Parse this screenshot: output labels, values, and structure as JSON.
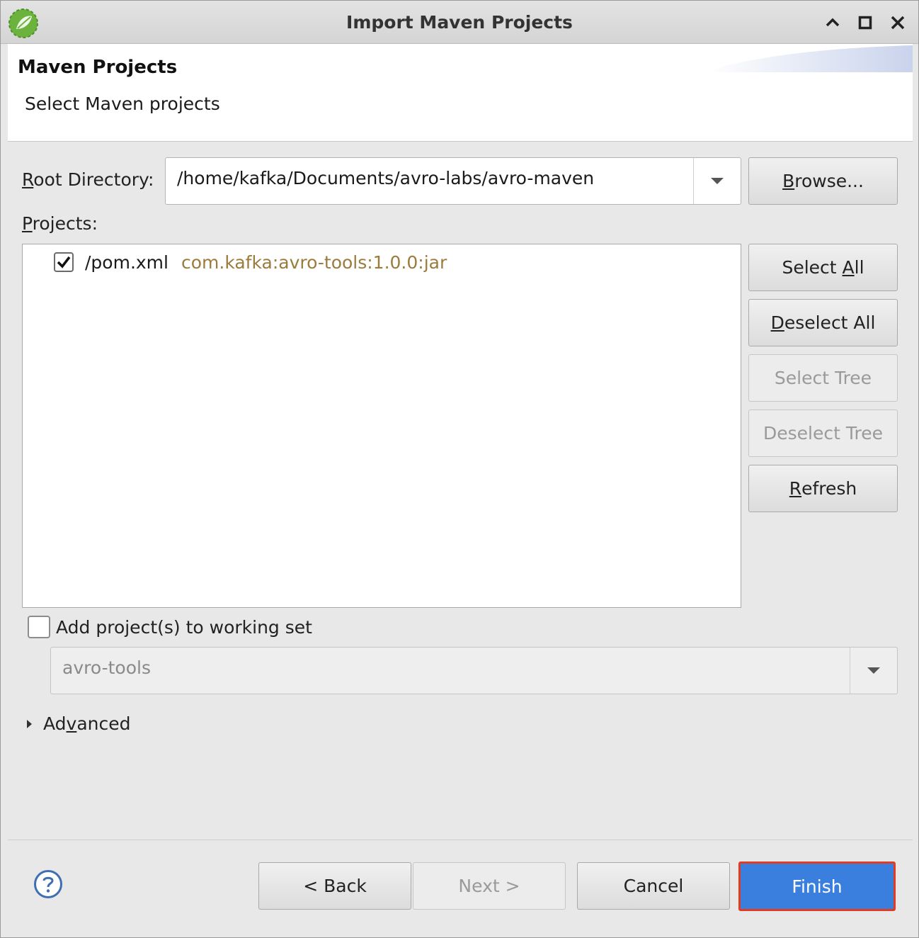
{
  "window": {
    "title": "Import Maven Projects"
  },
  "header": {
    "title": "Maven Projects",
    "subtitle": "Select Maven projects"
  },
  "root_directory": {
    "label_prefix": "",
    "label_mnemonic": "R",
    "label_rest": "oot Directory:",
    "value": "/home/kafka/Documents/avro-labs/avro-maven",
    "browse_mnemonic": "B",
    "browse_rest": "rowse..."
  },
  "projects": {
    "label_mnemonic": "P",
    "label_rest": "rojects:",
    "items": [
      {
        "name": "/pom.xml",
        "coordinates": "com.kafka:avro-tools:1.0.0:jar",
        "checked": true
      }
    ]
  },
  "side_buttons": {
    "select_all_prefix": "Select ",
    "select_all_mnemonic": "A",
    "select_all_rest": "ll",
    "deselect_all_mnemonic": "D",
    "deselect_all_rest": "eselect All",
    "select_tree": "Select Tree",
    "deselect_tree": "Deselect Tree",
    "refresh_mnemonic": "R",
    "refresh_rest": "efresh"
  },
  "working_set": {
    "checkbox_label": "Add project(s) to working set",
    "checked": false,
    "value": "avro-tools"
  },
  "advanced": {
    "prefix": "Ad",
    "mnemonic": "v",
    "rest": "anced"
  },
  "footer": {
    "back": "< Back",
    "next": "Next >",
    "cancel": "Cancel",
    "finish": "Finish"
  },
  "colors": {
    "finish_bg": "#3b7fde",
    "finish_border": "#e23b22",
    "coordinates": "#9c7b3c"
  }
}
